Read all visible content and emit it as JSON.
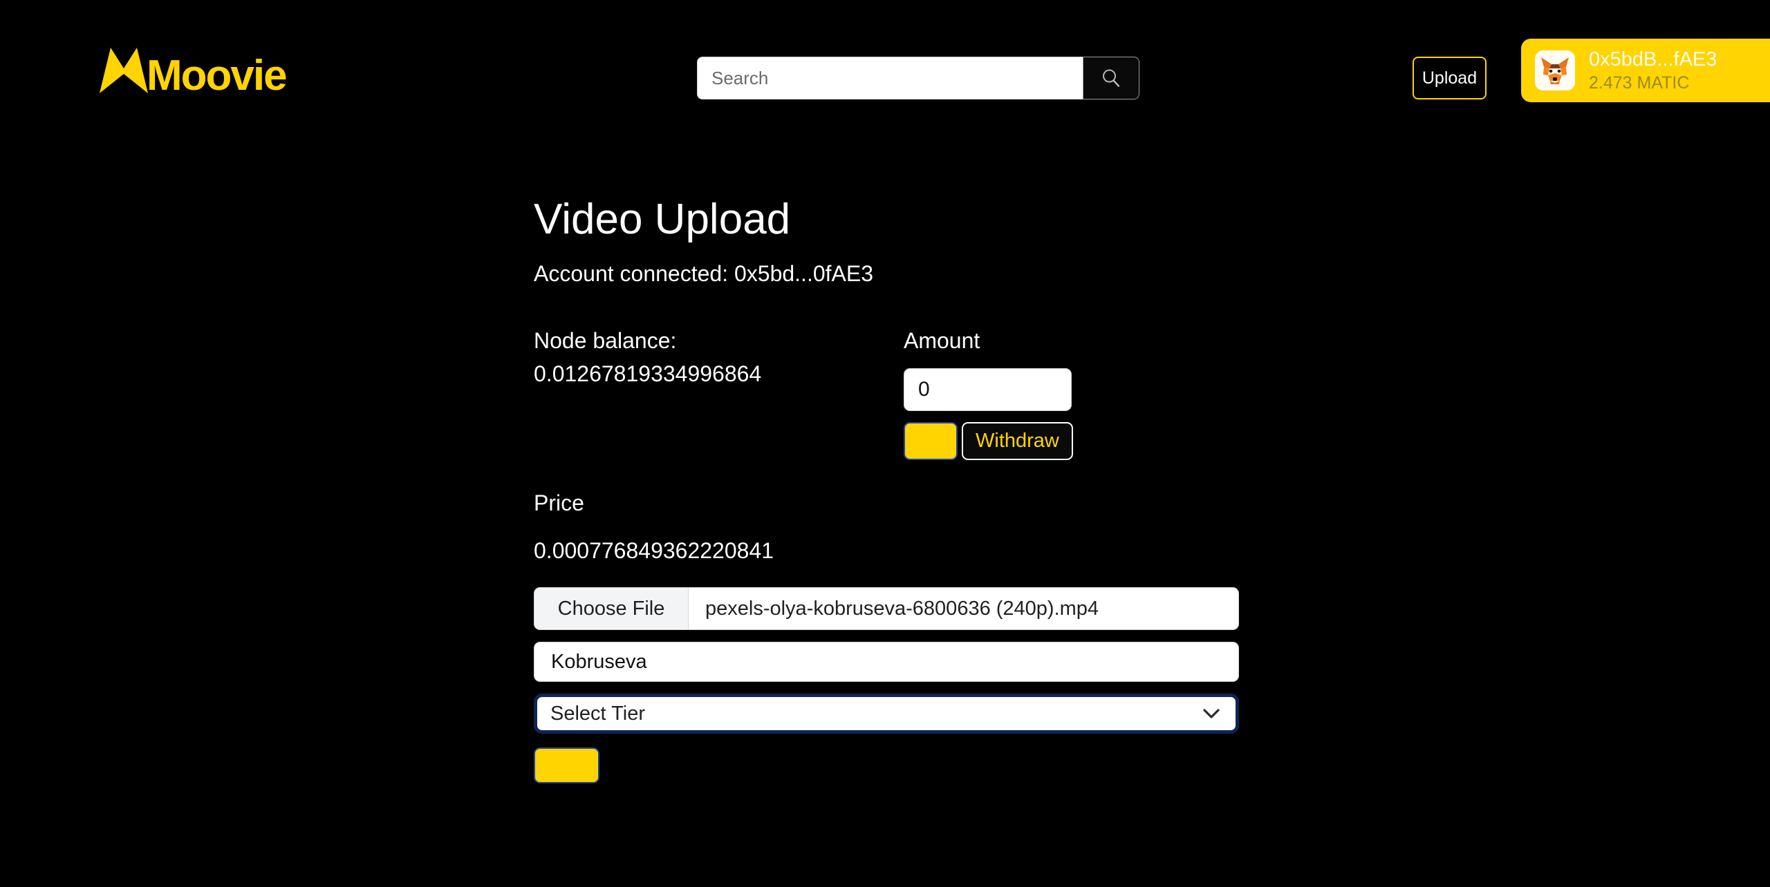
{
  "brand": {
    "name": "Moovie",
    "accent": "#FFD400",
    "background": "#000000"
  },
  "header": {
    "search": {
      "placeholder": "Search",
      "value": "",
      "icon": "search-icon"
    },
    "upload_label": "Upload",
    "wallet": {
      "icon": "metamask-fox-icon",
      "address": "0x5bdB...fAE3",
      "balance": "2.473 MATIC"
    }
  },
  "main": {
    "title": "Video Upload",
    "account_connected": "Account connected: 0x5bd...0fAE3",
    "node_balance_label": "Node balance:",
    "node_balance_value": "0.01267819334996864",
    "amount_label": "Amount",
    "amount_value": "0",
    "amount_placeholder": "",
    "deposit_label": "",
    "withdraw_label": "Withdraw",
    "price_label": "Price",
    "price_value": "0.000776849362220841",
    "file": {
      "choose_label": "Choose File",
      "file_name": "pexels-olya-kobruseva-6800636 (240p).mp4"
    },
    "video_title_value": "Kobruseva",
    "video_title_placeholder": "",
    "tier": {
      "selected": "Select Tier",
      "chevron": "chevron-down-icon"
    },
    "submit_label": ""
  }
}
